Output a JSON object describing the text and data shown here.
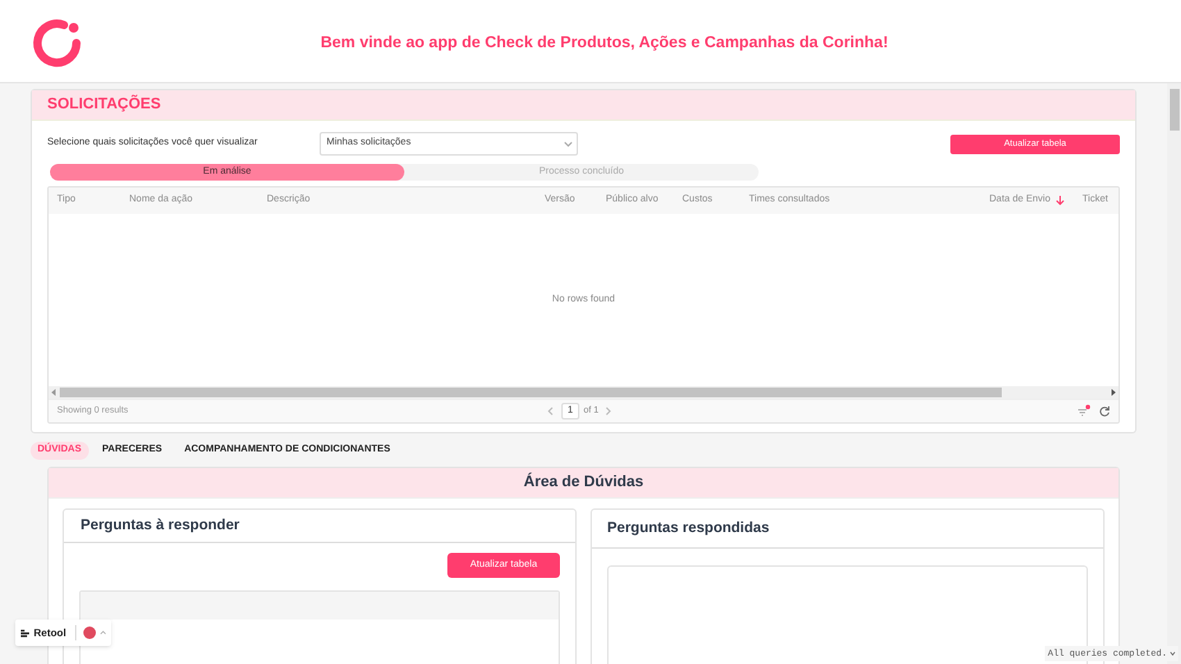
{
  "header": {
    "title": "Bem vinde ao app de Check de Produtos, Ações e Campanhas da Corinha!"
  },
  "solicitacoes": {
    "title": "SOLICITAÇÕES",
    "filter_label": "Selecione quais solicitações você quer visualizar",
    "select_value": "Minhas solicitações",
    "refresh_button": "Atualizar tabela",
    "segments": [
      {
        "label": "Em análise",
        "selected": true
      },
      {
        "label": "Processo concluído",
        "selected": false
      }
    ],
    "table": {
      "columns": [
        {
          "label": "Tipo",
          "sorted": false
        },
        {
          "label": "Nome da ação",
          "sorted": false
        },
        {
          "label": "Descrição",
          "sorted": false
        },
        {
          "label": "Versão",
          "sorted": false
        },
        {
          "label": "Público alvo",
          "sorted": false
        },
        {
          "label": "Custos",
          "sorted": false
        },
        {
          "label": "Times consultados",
          "sorted": false
        },
        {
          "label": "Data de Envio",
          "sorted": true
        },
        {
          "label": "Ticket",
          "sorted": false
        }
      ],
      "empty": "No rows found",
      "footer": "Showing 0 results",
      "page": "1",
      "page_total": "of 1"
    }
  },
  "tabs": [
    {
      "label": "DÚVIDAS",
      "selected": true
    },
    {
      "label": "PARECERES",
      "selected": false
    },
    {
      "label": "ACOMPANHAMENTO DE CONDICIONANTES",
      "selected": false
    }
  ],
  "duvidas": {
    "title": "Área de Dúvidas",
    "left": {
      "title": "Perguntas à responder",
      "button": "Atualizar tabela"
    },
    "right": {
      "title": "Perguntas respondidas"
    }
  },
  "retool_badge": "Retool",
  "status": "All queries completed."
}
